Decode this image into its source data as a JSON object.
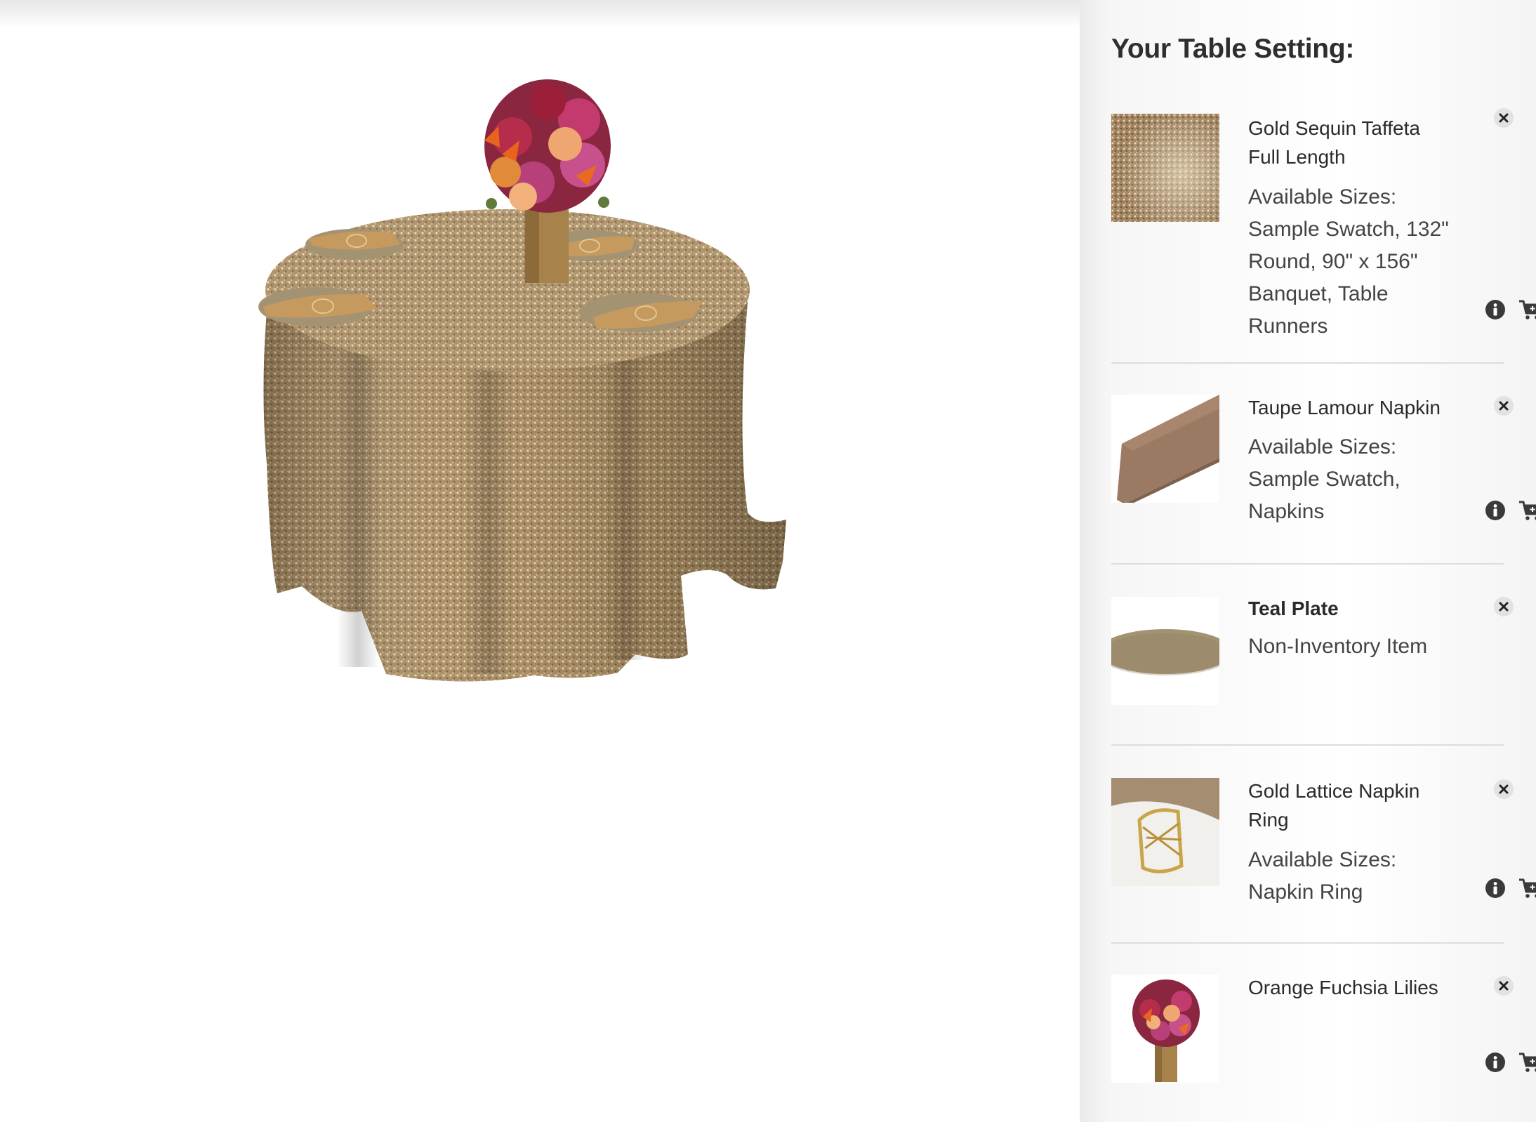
{
  "panel": {
    "title": "Your Table Setting:"
  },
  "items": [
    {
      "name_line1": "Gold Sequin Taffeta",
      "name_line2": "Full Length",
      "sizes_lines": [
        "Available Sizes:",
        "Sample Swatch, 132\"",
        "Round, 90\" x 156\"",
        "Banquet, Table",
        "Runners"
      ],
      "thumb_icon": "gold-sequin-swatch",
      "has_actions": true
    },
    {
      "name_line1": "Taupe Lamour Napkin",
      "sizes_lines": [
        "Available Sizes:",
        "Sample Swatch,",
        "Napkins"
      ],
      "thumb_icon": "taupe-napkin",
      "has_actions": true
    },
    {
      "name_line1": "Teal Plate",
      "sizes_lines": [
        "Non-Inventory Item"
      ],
      "thumb_icon": "plate",
      "has_actions": false
    },
    {
      "name_line1": "Gold Lattice Napkin",
      "name_line2": "Ring",
      "sizes_lines": [
        "Available Sizes:",
        "Napkin Ring"
      ],
      "thumb_icon": "napkin-ring",
      "has_actions": true
    },
    {
      "name_line1": "Orange Fuchsia Lilies",
      "sizes_lines": [],
      "thumb_icon": "flower-centerpiece",
      "has_actions": true
    }
  ],
  "icons": {
    "remove": "close-circle-icon",
    "info": "info-icon",
    "cart": "add-to-cart-icon"
  },
  "colors": {
    "gold_sequin": "#b79c73",
    "taupe": "#9b7a64",
    "plate": "#a49372",
    "napkin_fold": "#c69a5e",
    "text_dark": "#2a2a2a",
    "icon_dark": "#3a3a3a"
  }
}
